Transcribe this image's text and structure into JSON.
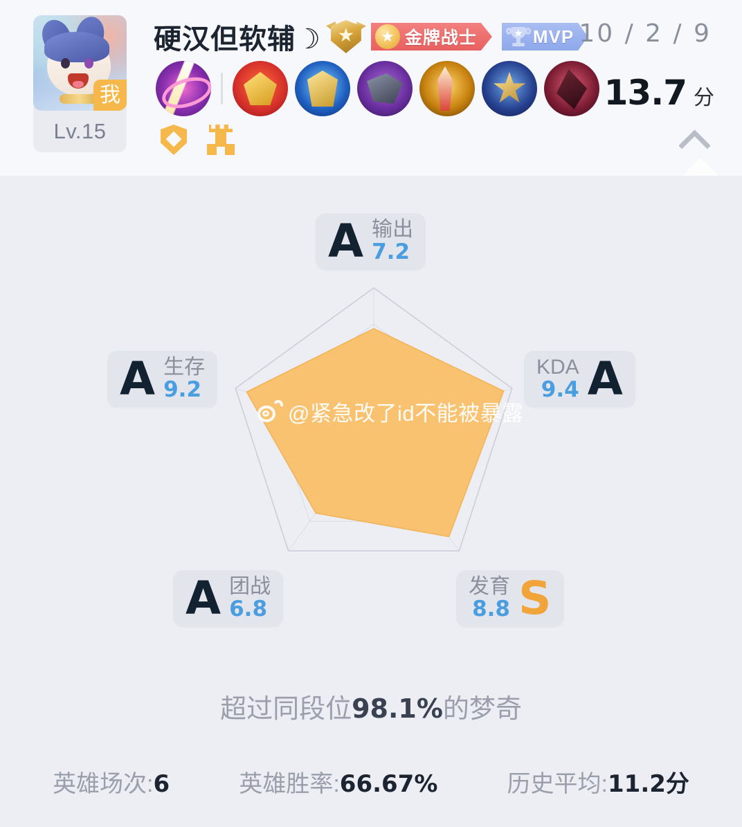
{
  "header": {
    "avatar": {
      "level_label": "Lv.15",
      "me_tag": "我"
    },
    "player_name": "硬汉但软辅☽",
    "rank_emblem_name": "rank-emblem",
    "badges": [
      {
        "id": "gold-warrior",
        "text": "金牌战士",
        "color": "#e8605f"
      },
      {
        "id": "mvp",
        "text": "MVP",
        "color": "#8ea8ea"
      }
    ],
    "kda_line": "10 / 2 / 9",
    "score": {
      "value": "13.7",
      "unit": "分"
    },
    "items": [
      "summoner-flash-icon",
      "item-red-crown-icon",
      "item-blue-armor-icon",
      "item-purple-axe-icon",
      "item-gold-blade-icon",
      "item-gold-star-icon",
      "item-crimson-blade-icon"
    ],
    "small_badges": [
      "shield-icon",
      "tower-icon"
    ],
    "collapse_icon": "chevron-up-icon"
  },
  "chart_data": {
    "type": "radar",
    "title": "",
    "max": 10,
    "categories": [
      "输出",
      "KDA",
      "发育",
      "团战",
      "生存"
    ],
    "values": [
      7.2,
      9.4,
      8.8,
      6.8,
      9.2
    ],
    "grades": [
      "A",
      "A",
      "S",
      "A",
      "A"
    ],
    "fill_color": "#f8c271",
    "grid_color": "#c9ccd8",
    "rings": [
      0.25,
      0.5,
      0.75,
      1.0
    ],
    "legend": "none"
  },
  "stats": [
    {
      "key": "output",
      "label": "输出",
      "value": "7.2",
      "grade": "A",
      "grade_side": "left",
      "grade_color": "a"
    },
    {
      "key": "survival",
      "label": "生存",
      "value": "9.2",
      "grade": "A",
      "grade_side": "left",
      "grade_color": "a"
    },
    {
      "key": "kda",
      "label": "KDA",
      "value": "9.4",
      "grade": "A",
      "grade_side": "right",
      "grade_color": "a"
    },
    {
      "key": "teamfight",
      "label": "团战",
      "value": "6.8",
      "grade": "A",
      "grade_side": "left",
      "grade_color": "a"
    },
    {
      "key": "develop",
      "label": "发育",
      "value": "8.8",
      "grade": "S",
      "grade_side": "right",
      "grade_color": "s"
    }
  ],
  "watermark": {
    "icon": "weibo-logo-icon",
    "text": "@紧急改了id不能被暴露"
  },
  "percentile": {
    "prefix": "超过同段位",
    "value": "98.1%",
    "suffix": "的梦奇"
  },
  "footer": [
    {
      "label": "英雄场次:",
      "value": "6"
    },
    {
      "label": "英雄胜率:",
      "value": "66.67%"
    },
    {
      "label": "历史平均:",
      "value": "11.2分"
    }
  ]
}
